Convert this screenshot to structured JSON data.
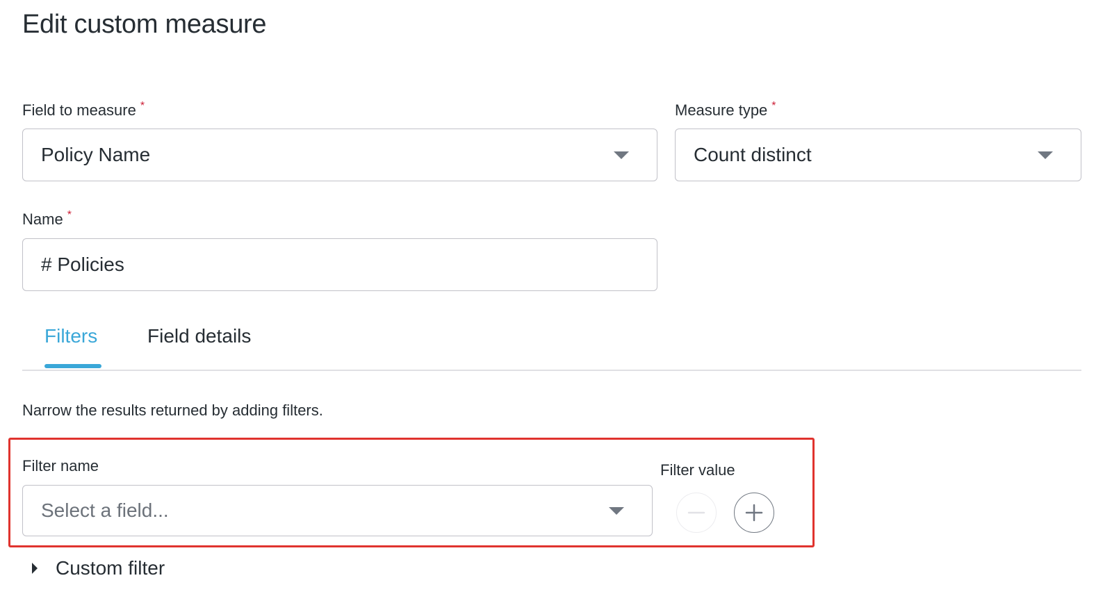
{
  "dialog": {
    "title": "Edit custom measure"
  },
  "form": {
    "field_to_measure": {
      "label": "Field to measure",
      "required_mark": "*",
      "value": "Policy Name",
      "caret_icon": "chevron-down-icon"
    },
    "measure_type": {
      "label": "Measure type",
      "required_mark": "*",
      "value": "Count distinct",
      "caret_icon": "chevron-down-icon"
    },
    "name": {
      "label": "Name",
      "required_mark": "*",
      "value": "# Policies"
    }
  },
  "tabs": [
    {
      "label": "Filters",
      "active": true
    },
    {
      "label": "Field details",
      "active": false
    }
  ],
  "filters": {
    "helper_text": "Narrow the results returned by adding filters.",
    "filter_name_label": "Filter name",
    "filter_name_placeholder": "Select a field...",
    "filter_value_label": "Filter value",
    "remove_icon": "minus-circle-icon",
    "add_icon": "plus-circle-icon",
    "custom_filter_label": "Custom filter",
    "highlight_color": "#e0332e"
  },
  "colors": {
    "accent": "#3aa7d8",
    "required": "#cc1f36",
    "text": "#262d33",
    "border": "#c1c1c8"
  }
}
